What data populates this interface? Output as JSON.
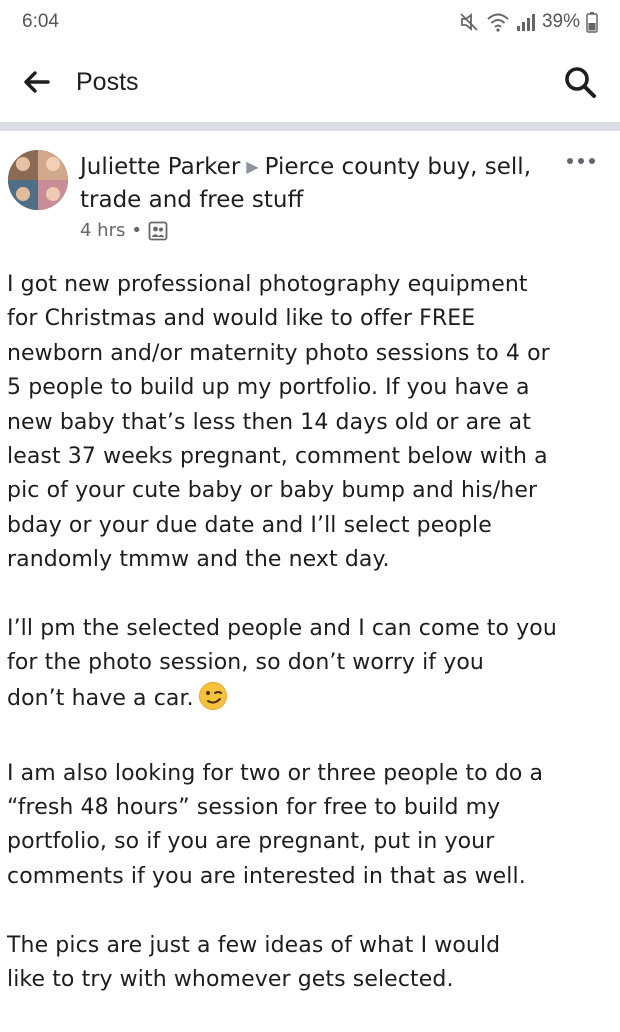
{
  "status_bar": {
    "time": "6:04",
    "battery": "39%",
    "icons": [
      "mute-icon",
      "wifi-icon",
      "signal-icon",
      "battery-icon"
    ]
  },
  "app_bar": {
    "title": "Posts",
    "back_icon": "back-arrow-icon",
    "search_icon": "search-icon"
  },
  "post": {
    "author": "Juliette Parker",
    "group": "Pierce county buy, sell, trade and free stuff",
    "time": "4 hrs",
    "separator": "•",
    "audience_icon": "group-members-icon",
    "more_icon": "more-options-icon",
    "paragraphs": [
      "I got new professional photography equipment\nfor Christmas and would like to offer FREE\nnewborn and/or maternity photo sessions to 4 or\n5 people to build up my portfolio.  If you have a\nnew baby that’s less then 14 days old or are at\nleast 37 weeks pregnant, comment below with a\npic of your cute baby or baby bump and his/her\nbday or your due date and I’ll select people\nrandomly tmmw and the next day.",
      "I’ll pm the selected people and I can come to you\nfor the photo session, so don’t worry if you\ndon’t have a car.",
      "I am also looking for two or three people to do a\n“fresh 48 hours” session for free to build my\nportfolio, so if you are pregnant, put in your\ncomments if you are interested in that as well.",
      "The pics are just a few ideas of what I would\nlike to try with whomever gets selected."
    ],
    "emoji": "winking-face-emoji"
  },
  "colors": {
    "divider": "#dadde1",
    "meta_text": "#65676b",
    "primary_text": "#1c1e21",
    "emoji_yellow": "#f7c23b"
  }
}
